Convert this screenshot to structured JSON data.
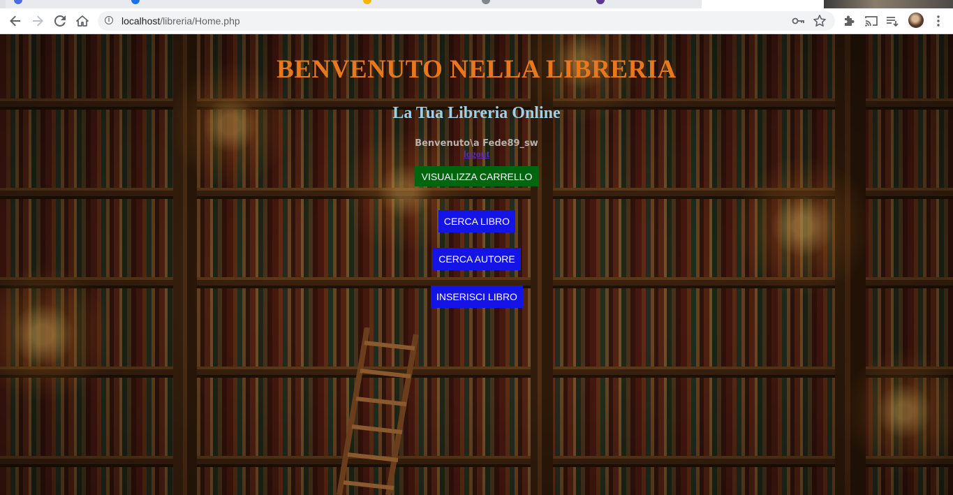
{
  "browser": {
    "url_host": "localhost",
    "url_path": "/libreria/Home.php",
    "icons": {
      "back": "arrow-left-icon",
      "forward": "arrow-right-icon",
      "reload": "reload-icon",
      "home": "home-icon",
      "site_info": "info-icon",
      "password": "key-icon",
      "bookmark": "star-icon",
      "extensions": "puzzle-icon",
      "cast": "cast-icon",
      "reading_list": "reading-list-icon",
      "menu": "kebab-menu-icon"
    }
  },
  "page": {
    "title": "BENVENUTO NELLA LIBRERIA",
    "subtitle": "La Tua Libreria Online",
    "welcome": "Benvenuto\\a Fede89_sw",
    "logout": "logout",
    "buttons": {
      "cart": "VISUALIZZA CARRELLO",
      "search_book": "CERCA LIBRO",
      "search_author": "CERCA AUTORE",
      "insert_book": "INSERISCI LIBRO"
    }
  },
  "colors": {
    "title": "#e8781e",
    "subtitle": "#9fd0e6",
    "welcome": "#b8b0aa",
    "logout": "#5b2ea8",
    "cart_button": "#00660d",
    "action_button": "#1414e6"
  }
}
